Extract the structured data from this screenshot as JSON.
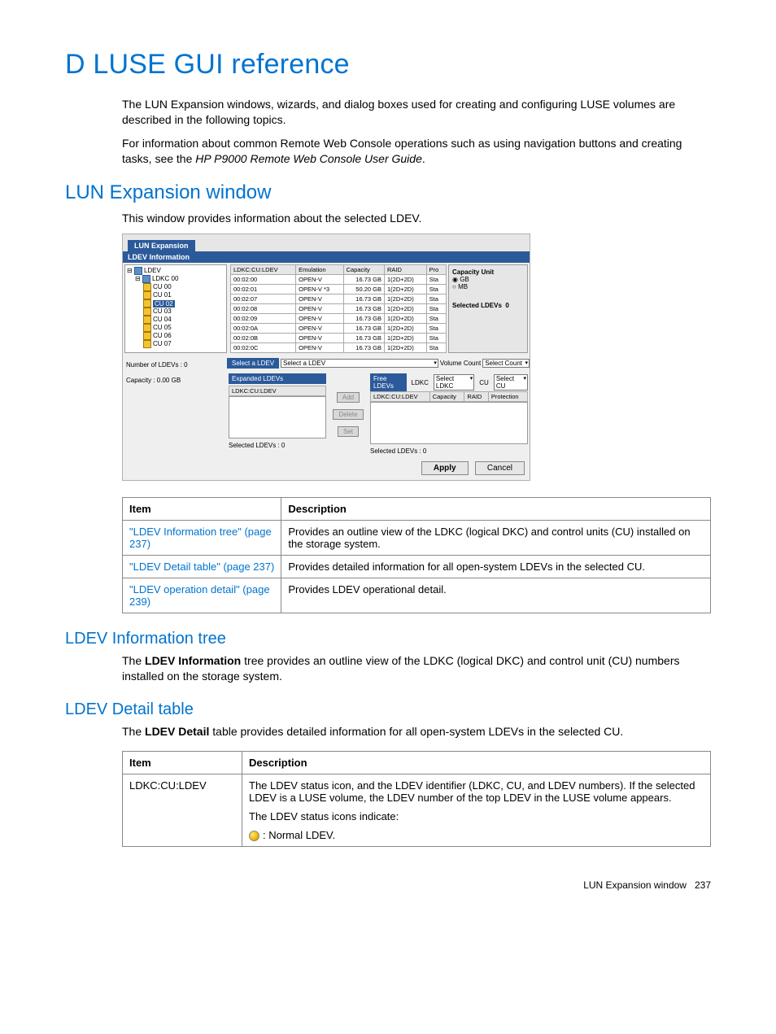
{
  "page_title": "D LUSE GUI reference",
  "intro_p1": "The LUN Expansion windows, wizards, and dialog boxes used for creating and configuring LUSE volumes are described in the following topics.",
  "intro_p2_a": "For information about common Remote Web Console operations such as using navigation buttons and creating tasks, see the ",
  "intro_p2_b": "HP P9000 Remote Web Console User Guide",
  "intro_p2_c": ".",
  "sec1": {
    "title": "LUN Expansion window",
    "lead": "This window provides information about the selected LDEV."
  },
  "screenshot": {
    "tab": "LUN Expansion",
    "header": "LDEV Information",
    "tree": {
      "root": "LDEV",
      "ldkc": "LDKC 00",
      "cus": [
        "CU 00",
        "CU 01",
        "CU 02",
        "CU 03",
        "CU 04",
        "CU 05",
        "CU 06",
        "CU 07"
      ],
      "selected": "CU 02"
    },
    "ldev_table": {
      "cols": [
        "LDKC:CU:LDEV",
        "Emulation",
        "Capacity",
        "RAID",
        "Pro"
      ],
      "rows": [
        [
          "00:02:00",
          "OPEN-V",
          "16.73 GB",
          "1(2D+2D)",
          "Sta"
        ],
        [
          "00:02:01",
          "OPEN-V *3",
          "50.20 GB",
          "1(2D+2D)",
          "Sta"
        ],
        [
          "00:02:07",
          "OPEN-V",
          "16.73 GB",
          "1(2D+2D)",
          "Sta"
        ],
        [
          "00:02:08",
          "OPEN-V",
          "16.73 GB",
          "1(2D+2D)",
          "Sta"
        ],
        [
          "00:02:09",
          "OPEN-V",
          "16.73 GB",
          "1(2D+2D)",
          "Sta"
        ],
        [
          "00:02:0A",
          "OPEN-V",
          "16.73 GB",
          "1(2D+2D)",
          "Sta"
        ],
        [
          "00:02:0B",
          "OPEN-V",
          "16.73 GB",
          "1(2D+2D)",
          "Sta"
        ],
        [
          "00:02:0C",
          "OPEN-V",
          "16.73 GB",
          "1(2D+2D)",
          "Sta"
        ]
      ]
    },
    "capacity_unit": {
      "title": "Capacity Unit",
      "gb": "GB",
      "mb": "MB",
      "selected_label": "Selected LDEVs",
      "selected_value": "0"
    },
    "left_info": {
      "num_ldevs_label": "Number of LDEVs",
      "num_ldevs_value": ": 0",
      "capacity_label": "Capacity",
      "capacity_value": ": 0.00 GB"
    },
    "select_ldev": {
      "title": "Select a LDEV",
      "dropdown": "Select a LDEV",
      "volume_count_label": "Volume Count",
      "volume_count_value": "Select Count"
    },
    "expanded": {
      "title": "Expanded LDEVs",
      "col": "LDKC:CU:LDEV",
      "footer": "Selected LDEVs : 0"
    },
    "mid_buttons": {
      "add": "Add",
      "delete": "Delete",
      "set": "Set"
    },
    "free": {
      "title": "Free LDEVs",
      "ldkc_label": "LDKC",
      "ldkc_value": "Select LDKC",
      "cu_label": "CU",
      "cu_value": "Select CU",
      "cols": [
        "LDKC:CU:LDEV",
        "Capacity",
        "RAID",
        "Protection"
      ],
      "footer": "Selected LDEVs : 0"
    },
    "actions": {
      "apply": "Apply",
      "cancel": "Cancel"
    }
  },
  "table1": {
    "headers": [
      "Item",
      "Description"
    ],
    "rows": [
      {
        "item": "\"LDEV Information tree\" (page 237)",
        "desc": "Provides an outline view of the LDKC (logical DKC) and control units (CU) installed on the storage system."
      },
      {
        "item": "\"LDEV Detail table\" (page 237)",
        "desc": "Provides detailed information for all open-system LDEVs in the selected CU."
      },
      {
        "item": "\"LDEV operation detail\" (page 239)",
        "desc": "Provides LDEV operational detail."
      }
    ]
  },
  "sec2": {
    "title": "LDEV Information tree",
    "p_a": "The ",
    "p_b": "LDEV Information",
    "p_c": " tree provides an outline view of the LDKC (logical DKC) and control unit (CU) numbers installed on the storage system."
  },
  "sec3": {
    "title": "LDEV Detail table",
    "p_a": "The ",
    "p_b": "LDEV Detail",
    "p_c": " table provides detailed information for all open-system LDEVs in the selected CU."
  },
  "table2": {
    "headers": [
      "Item",
      "Description"
    ],
    "row": {
      "item": "LDKC:CU:LDEV",
      "desc_l1": "The LDEV status icon, and the LDEV identifier (LDKC, CU, and LDEV numbers). If the selected LDEV is a LUSE volume, the LDEV number of the top LDEV in the LUSE volume appears.",
      "desc_l2": "The LDEV status icons indicate:",
      "desc_l3": ": Normal LDEV."
    }
  },
  "footer": {
    "label": "LUN Expansion window",
    "page": "237"
  }
}
